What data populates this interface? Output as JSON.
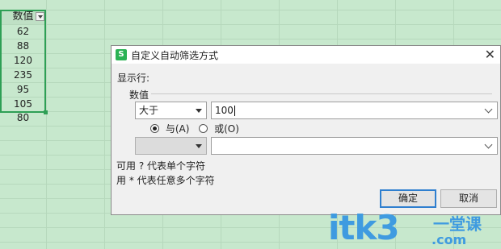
{
  "spreadsheet": {
    "header": "数值",
    "values": [
      "62",
      "88",
      "120",
      "235",
      "95",
      "105",
      "80"
    ]
  },
  "dialog": {
    "title": "自定义自动筛选方式",
    "icon_text": "S",
    "show_rows_label": "显示行:",
    "field_label": "数值",
    "condition1": {
      "operator": "大于",
      "value": "100"
    },
    "logic": {
      "and_label": "与(A)",
      "or_label": "或(O)",
      "selected": "and"
    },
    "condition2": {
      "operator": "",
      "value": ""
    },
    "hint1": "可用 ? 代表单个字符",
    "hint2": "用 * 代表任意多个字符",
    "ok_label": "确定",
    "cancel_label": "取消"
  },
  "watermark": {
    "main": "itk3",
    "sub": "一堂课",
    "domain": ".com"
  },
  "colors": {
    "sheet_bg": "#c7e8cd",
    "selection": "#2e9f55",
    "accent": "#2f7fcf",
    "watermark": "#3f9be0"
  },
  "icons": {
    "close": "close-icon",
    "filter": "filter-dropdown-icon",
    "app": "wps-spreadsheet-icon"
  }
}
